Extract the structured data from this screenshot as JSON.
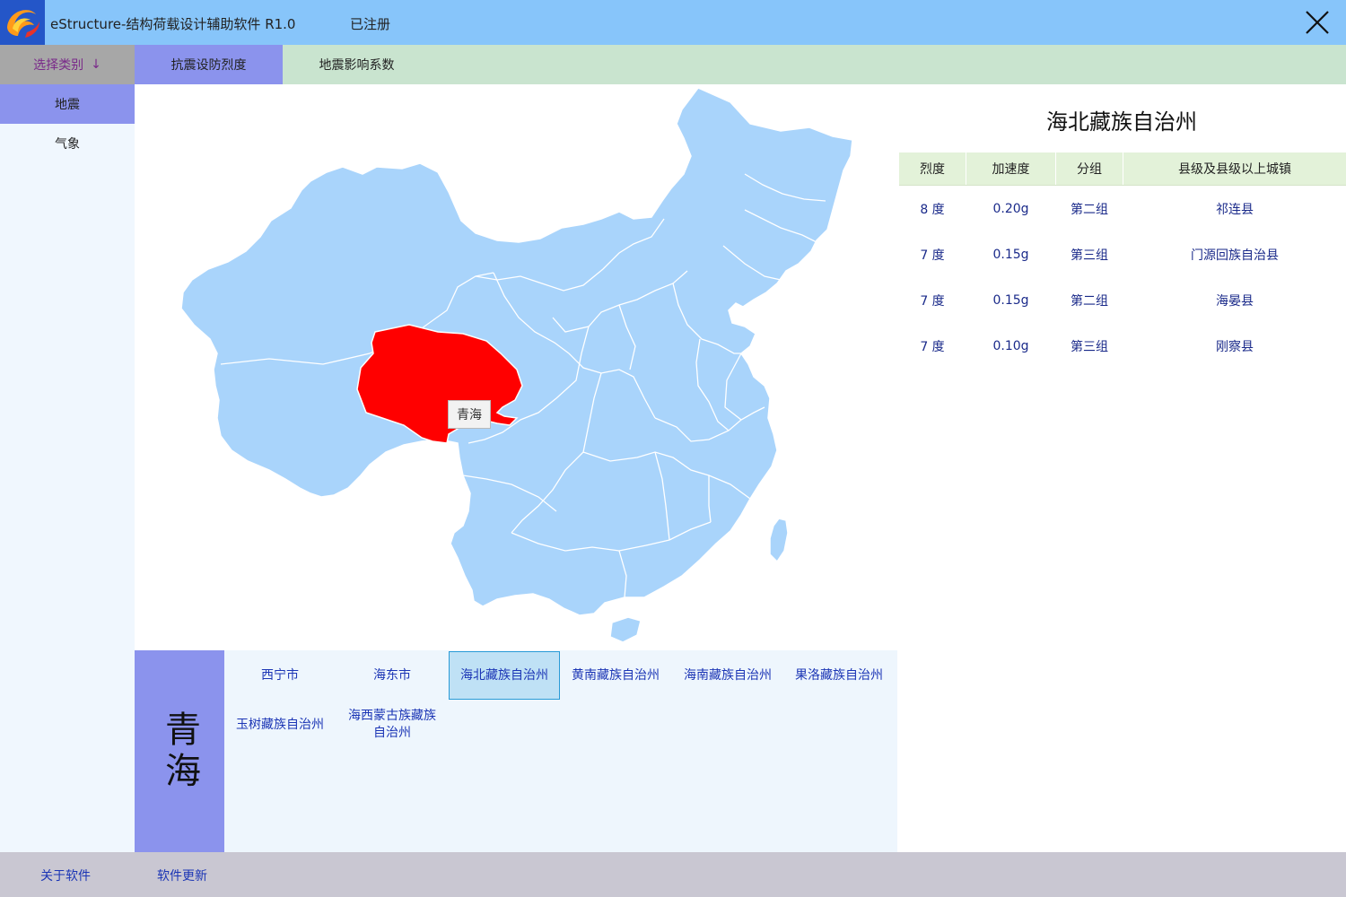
{
  "app": {
    "title": "eStructure-结构荷载设计辅助软件 R1.0",
    "registration": "已注册"
  },
  "category_header": {
    "label": "选择类别",
    "arrow": "↓"
  },
  "tabs": [
    {
      "label": "抗震设防烈度",
      "active": true
    },
    {
      "label": "地震影响系数",
      "active": false
    }
  ],
  "sidebar": {
    "items": [
      {
        "label": "地震",
        "active": true
      },
      {
        "label": "气象",
        "active": false
      }
    ]
  },
  "map": {
    "tooltip": "青海",
    "highlighted_province": "青海",
    "colors": {
      "land": "#a9d4fb",
      "highlight": "#ff0000",
      "border": "#ffffff"
    }
  },
  "province": {
    "name": "青海"
  },
  "cities": [
    {
      "label": "西宁市",
      "selected": false
    },
    {
      "label": "海东市",
      "selected": false
    },
    {
      "label": "海北藏族自治州",
      "selected": true
    },
    {
      "label": "黄南藏族自治州",
      "selected": false
    },
    {
      "label": "海南藏族自治州",
      "selected": false
    },
    {
      "label": "果洛藏族自治州",
      "selected": false
    },
    {
      "label": "玉树藏族自治州",
      "selected": false
    },
    {
      "label": "海西蒙古族藏族自治州",
      "selected": false
    }
  ],
  "info": {
    "title": "海北藏族自治州",
    "columns": [
      "烈度",
      "加速度",
      "分组",
      "县级及县级以上城镇"
    ],
    "rows": [
      {
        "intensity": "8 度",
        "acceleration": "0.20g",
        "group": "第二组",
        "town": "祁连县"
      },
      {
        "intensity": "7 度",
        "acceleration": "0.15g",
        "group": "第三组",
        "town": "门源回族自治县"
      },
      {
        "intensity": "7 度",
        "acceleration": "0.15g",
        "group": "第二组",
        "town": "海晏县"
      },
      {
        "intensity": "7 度",
        "acceleration": "0.10g",
        "group": "第三组",
        "town": "刚察县"
      }
    ]
  },
  "footer": {
    "about": "关于软件",
    "update": "软件更新"
  }
}
